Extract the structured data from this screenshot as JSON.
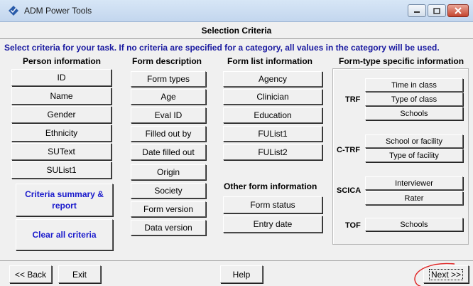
{
  "window": {
    "title": "ADM Power Tools",
    "controls": [
      "minimize",
      "maximize",
      "close"
    ]
  },
  "header": {
    "section_title": "Selection Criteria",
    "instructions": "Select criteria for your task.  If no criteria are specified for a category, all values in the category will be used."
  },
  "columns": {
    "person": "Person information",
    "form_description": "Form description",
    "form_list": "Form list information",
    "formtype": "Form-type specific information",
    "other_form": "Other form information"
  },
  "person_buttons": [
    "ID",
    "Name",
    "Gender",
    "Ethnicity",
    "SUText",
    "SUList1"
  ],
  "action_buttons": {
    "summary_line1": "Criteria summary &",
    "summary_line2": "report",
    "clear": "Clear all criteria"
  },
  "form_description_buttons": [
    "Form types",
    "Age",
    "Eval ID",
    "Filled out by",
    "Date filled out",
    "Origin",
    "Society",
    "Form version",
    "Data version"
  ],
  "form_list_buttons": [
    "Agency",
    "Clinician",
    "Education",
    "FUList1",
    "FUList2"
  ],
  "other_form_buttons": [
    "Form status",
    "Entry date"
  ],
  "formtype_groups": {
    "trf": {
      "label": "TRF",
      "buttons": [
        "Time in class",
        "Type of class",
        "Schools"
      ]
    },
    "ctrf": {
      "label": "C-TRF",
      "buttons": [
        "School or facility",
        "Type of facility"
      ]
    },
    "scica": {
      "label": "SCICA",
      "buttons": [
        "Interviewer",
        "Rater"
      ]
    },
    "tof": {
      "label": "TOF",
      "buttons": [
        "Schools"
      ]
    }
  },
  "footer": {
    "back": "<< Back",
    "exit": "Exit",
    "help": "Help",
    "next": "Next >>"
  },
  "colors": {
    "instructions_text": "#1a1aa0",
    "action_text": "#1a1acc",
    "annotation": "#e02020"
  }
}
